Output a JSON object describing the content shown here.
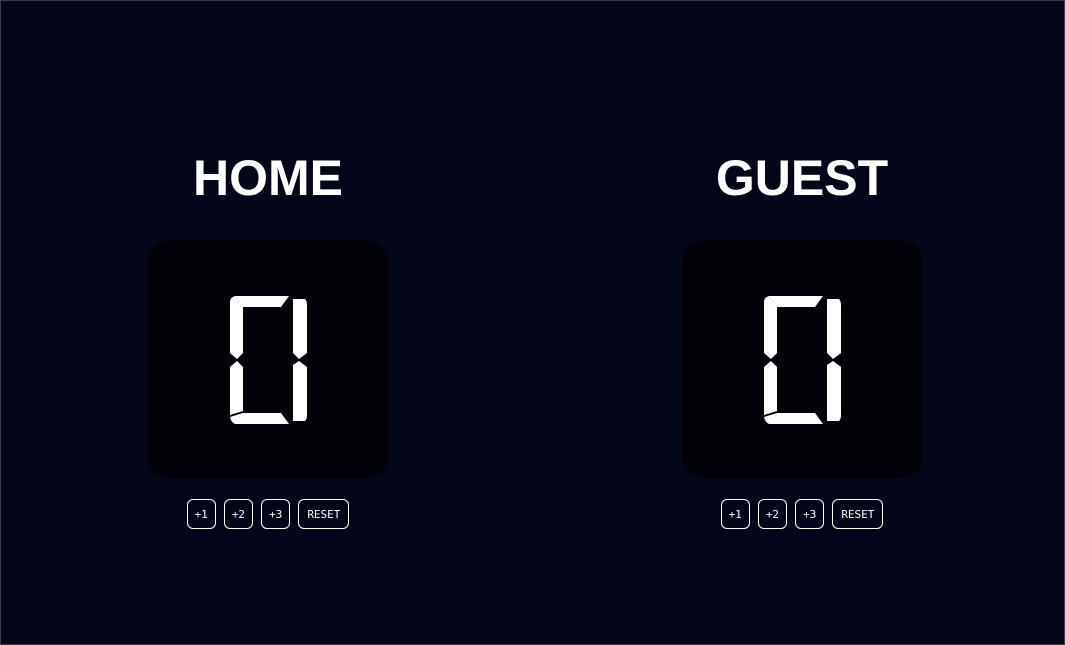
{
  "home": {
    "title": "HOME",
    "score": "0",
    "buttons": [
      "+1",
      "+2",
      "+3",
      "RESET"
    ]
  },
  "guest": {
    "title": "GUEST",
    "score": "0",
    "buttons": [
      "+1",
      "+2",
      "+3",
      "RESET"
    ]
  },
  "colors": {
    "background": "#04061a",
    "score_panel": "#010208",
    "text": "#ffffff"
  }
}
